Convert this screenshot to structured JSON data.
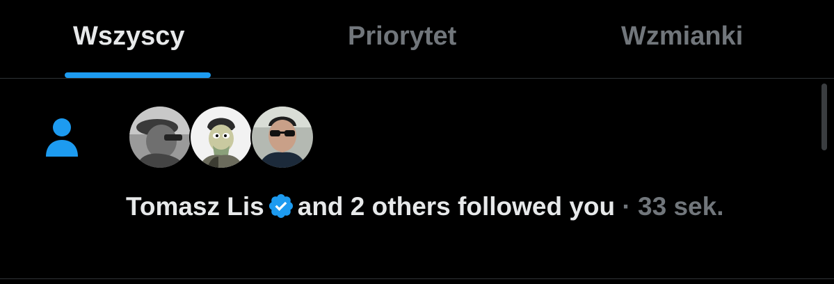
{
  "tabs": [
    {
      "label": "Wszyscy",
      "active": true
    },
    {
      "label": "Priorytet",
      "active": false
    },
    {
      "label": "Wzmianki",
      "active": false
    }
  ],
  "notification": {
    "type_icon": "person-icon",
    "avatars": [
      "avatar-photo-gray",
      "avatar-cartoon-character",
      "avatar-sunglasses-man"
    ],
    "user_name": "Tomasz Lis",
    "verified": true,
    "message": "and 2 others followed you",
    "separator": "·",
    "time": "33 sek."
  },
  "colors": {
    "background": "#000000",
    "text_primary": "#e7e9ea",
    "text_secondary": "#71767b",
    "accent": "#1d9bf0",
    "divider": "#2f3336"
  }
}
